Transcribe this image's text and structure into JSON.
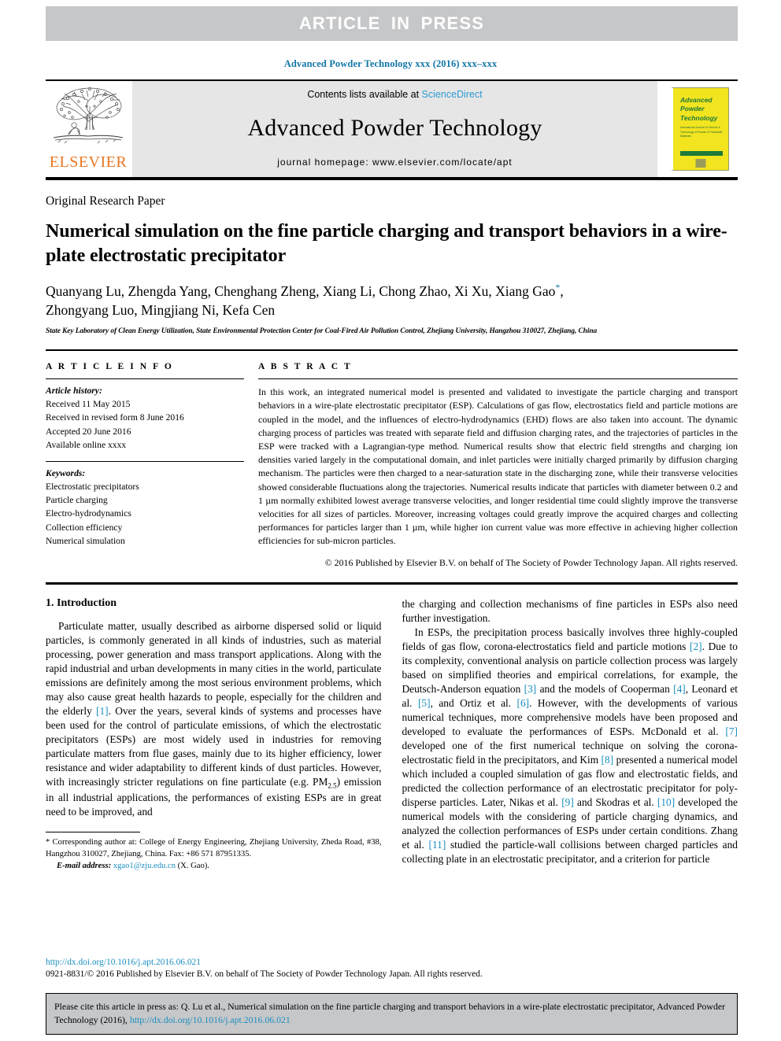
{
  "banner": {
    "text": "ARTICLE  IN  PRESS"
  },
  "journal_ref": "Advanced Powder Technology xxx (2016) xxx–xxx",
  "masthead": {
    "publisher": "ELSEVIER",
    "contents_prefix": "Contents lists available at ",
    "contents_link": "ScienceDirect",
    "journal_title": "Advanced Powder Technology",
    "homepage": "journal homepage: www.elsevier.com/locate/apt",
    "cover": {
      "line1": "Advanced",
      "line2": "Powder",
      "line3": "Technology",
      "subtitle": "International Journal of Science & Technology of Powder & Particulate Materials"
    }
  },
  "article": {
    "type": "Original Research Paper",
    "title": "Numerical simulation on the fine particle charging and transport behaviors in a wire-plate electrostatic precipitator",
    "authors": "Quanyang Lu, Zhengda Yang, Chenghang Zheng, Xiang Li, Chong Zhao, Xi Xu, Xiang Gao",
    "authors_cont": "Zhongyang Luo, Mingjiang Ni, Kefa Cen",
    "corresponding_mark": "*",
    "affiliation": "State Key Laboratory of Clean Energy Utilization, State Environmental Protection Center for Coal-Fired Air Pollution Control, Zhejiang University, Hangzhou 310027, Zhejiang, China"
  },
  "info": {
    "heading": "A R T I C L E   I N F O",
    "history_label": "Article history:",
    "history": [
      "Received 11 May 2015",
      "Received in revised form 8 June 2016",
      "Accepted 20 June 2016",
      "Available online xxxx"
    ],
    "keywords_label": "Keywords:",
    "keywords": [
      "Electrostatic precipitators",
      "Particle charging",
      "Electro-hydrodynamics",
      "Collection efficiency",
      "Numerical simulation"
    ]
  },
  "abstract": {
    "heading": "A B S T R A C T",
    "text": "In this work, an integrated numerical model is presented and validated to investigate the particle charging and transport behaviors in a wire-plate electrostatic precipitator (ESP). Calculations of gas flow, electrostatics field and particle motions are coupled in the model, and the influences of electro-hydrodynamics (EHD) flows are also taken into account. The dynamic charging process of particles was treated with separate field and diffusion charging rates, and the trajectories of particles in the ESP were tracked with a Lagrangian-type method. Numerical results show that electric field strengths and charging ion densities varied largely in the computational domain, and inlet particles were initially charged primarily by diffusion charging mechanism. The particles were then charged to a near-saturation state in the discharging zone, while their transverse velocities showed considerable fluctuations along the trajectories. Numerical results indicate that particles with diameter between 0.2 and 1 µm normally exhibited lowest average transverse velocities, and longer residential time could slightly improve the transverse velocities for all sizes of particles. Moreover, increasing voltages could greatly improve the acquired charges and collecting performances for particles larger than 1 µm, while higher ion current value was more effective in achieving higher collection efficiencies for sub-micron particles.",
    "copyright": "© 2016 Published by Elsevier B.V. on behalf of The Society of Powder Technology Japan. All rights reserved."
  },
  "intro": {
    "heading": "1. Introduction",
    "left_p1": "Particulate matter, usually described as airborne dispersed solid or liquid particles, is commonly generated in all kinds of industries, such as material processing, power generation and mass transport applications. Along with the rapid industrial and urban developments in many cities in the world, particulate emissions are definitely among the most serious environment problems, which may also cause great health hazards to people, especially for the children and the elderly ",
    "left_ref1": "[1]",
    "left_p1b": ". Over the years, several kinds of systems and processes have been used for the control of particulate emissions, of which the electrostatic precipitators (ESPs) are most widely used in industries for removing particulate matters from flue gases, mainly due to its higher efficiency, lower resistance and wider adaptability to different kinds of dust particles. However, with increasingly stricter regulations on fine particulate (e.g. PM",
    "left_sub": "2.5",
    "left_p1c": ") emission in all industrial applications, the performances of existing ESPs are in great need to be improved, and",
    "right_p1": "the charging and collection mechanisms of fine particles in ESPs also need further investigation.",
    "right_p2a": "In ESPs, the precipitation process basically involves three highly-coupled fields of gas flow, corona-electrostatics field and particle motions ",
    "right_ref2": "[2]",
    "right_p2b": ". Due to its complexity, conventional analysis on particle collection process was largely based on simplified theories and empirical correlations, for example, the Deutsch-Anderson equation ",
    "right_ref3": "[3]",
    "right_p2c": " and the models of Cooperman ",
    "right_ref4": "[4]",
    "right_p2d": ", Leonard et al. ",
    "right_ref5": "[5]",
    "right_p2e": ", and Ortiz et al. ",
    "right_ref6": "[6]",
    "right_p2f": ". However, with the developments of various numerical techniques, more comprehensive models have been proposed and developed to evaluate the performances of ESPs. McDonald et al. ",
    "right_ref7": "[7]",
    "right_p2g": " developed one of the first numerical technique on solving the corona-electrostatic field in the precipitators, and Kim ",
    "right_ref8": "[8]",
    "right_p2h": " presented a numerical model which included a coupled simulation of gas flow and electrostatic fields, and predicted the collection performance of an electrostatic precipitator for poly-disperse particles. Later, Nikas et al. ",
    "right_ref9": "[9]",
    "right_p2i": " and Skodras et al. ",
    "right_ref10": "[10]",
    "right_p2j": " developed the numerical models with the considering of particle charging dynamics, and analyzed the collection performances of ESPs under certain conditions. Zhang et al. ",
    "right_ref11": "[11]",
    "right_p2k": " studied the particle-wall collisions between charged particles and collecting plate in an electrostatic precipitator, and a criterion for particle"
  },
  "footnote": {
    "mark": "*",
    "text": " Corresponding author at: College of Energy Engineering, Zhejiang University, Zheda Road, #38, Hangzhou 310027, Zhejiang, China. Fax: +86 571 87951335.",
    "email_label": "E-mail address:",
    "email": "xgao1@zju.edu.cn",
    "email_suffix": " (X. Gao)."
  },
  "bottom": {
    "doi": "http://dx.doi.org/10.1016/j.apt.2016.06.021",
    "issn": "0921-8831/© 2016 Published by Elsevier B.V. on behalf of The Society of Powder Technology Japan. All rights reserved."
  },
  "citation_box": {
    "text_before": "Please cite this article in press as: Q. Lu et al., Numerical simulation on the fine particle charging and transport behaviors in a wire-plate electrostatic precipitator, Advanced Powder Technology (2016), ",
    "link": "http://dx.doi.org/10.1016/j.apt.2016.06.021"
  },
  "colors": {
    "banner_bg": "#c6c7c9",
    "link_blue": "#1b8ec2",
    "journal_ref_blue": "#1277a8",
    "sciencedirect_blue": "#2c9bd4",
    "elsevier_orange": "#e87722",
    "cover_yellow": "#f2e41e",
    "cover_green": "#1e7b3a",
    "masthead_gray": "#e6e6e6"
  }
}
